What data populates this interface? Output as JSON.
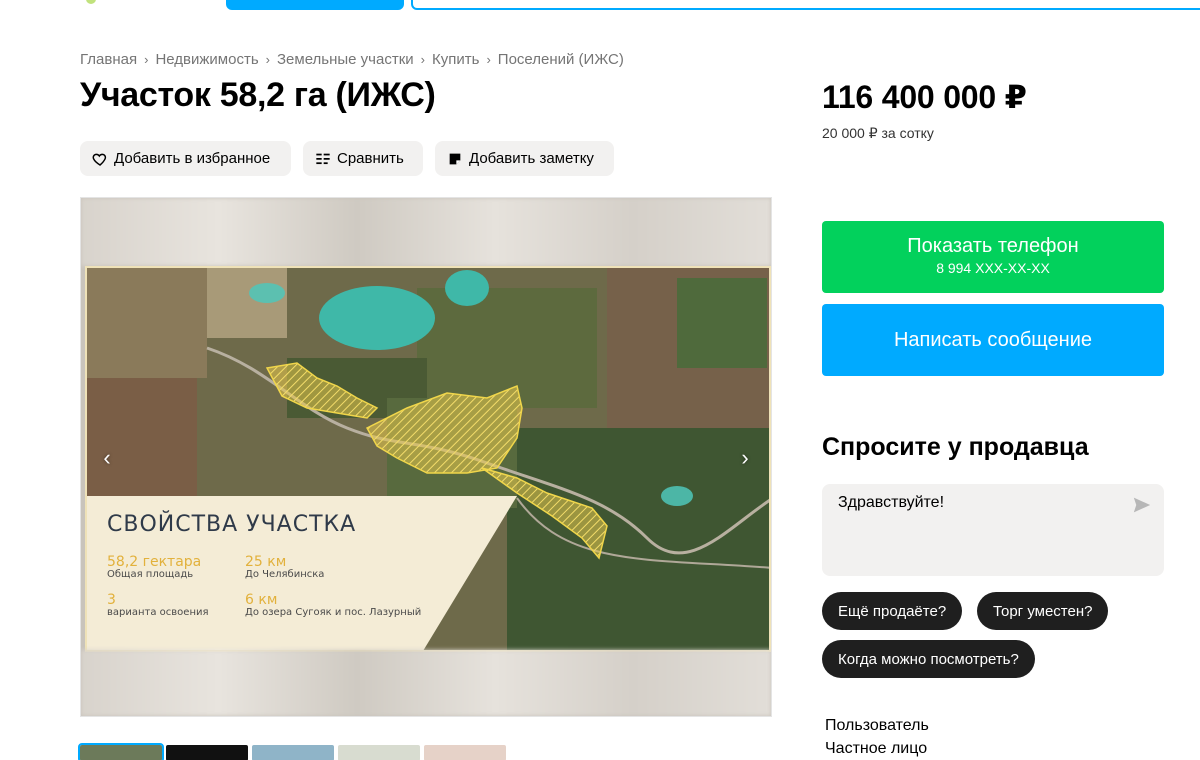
{
  "breadcrumb": [
    "Главная",
    "Недвижимость",
    "Земельные участки",
    "Купить",
    "Поселений (ИЖС)"
  ],
  "listing": {
    "title": "Участок 58,2 га (ИЖС)",
    "price": "116 400 000 ₽",
    "price_per": "20 000 ₽ за сотку"
  },
  "actions": {
    "favorite": "Добавить в избранное",
    "compare": "Сравнить",
    "note": "Добавить заметку"
  },
  "photo": {
    "panel_title": "СВОЙСТВА УЧАСТКА",
    "props": [
      {
        "value": "58,2 гектара",
        "label": "Общая площадь"
      },
      {
        "value": "25 км",
        "label": "До Челябинска"
      },
      {
        "value": "3",
        "label": "варианта освоения"
      },
      {
        "value": "6 км",
        "label": "До озера Сугояк и пос. Лазурный"
      }
    ]
  },
  "contact": {
    "show_phone": "Показать телефон",
    "phone_masked": "8 994 XXX-XX-XX",
    "write_message": "Написать сообщение"
  },
  "ask": {
    "title": "Спросите у продавца",
    "message": "Здравствуйте!",
    "quick_questions": [
      "Ещё продаёте?",
      "Торг уместен?",
      "Когда можно посмотреть?"
    ]
  },
  "seller": {
    "label": "Пользователь",
    "type": "Частное лицо"
  },
  "colors": {
    "phone_button": "#02d15c",
    "message_button": "#00aaff",
    "accent_gold": "#e2b13c"
  }
}
